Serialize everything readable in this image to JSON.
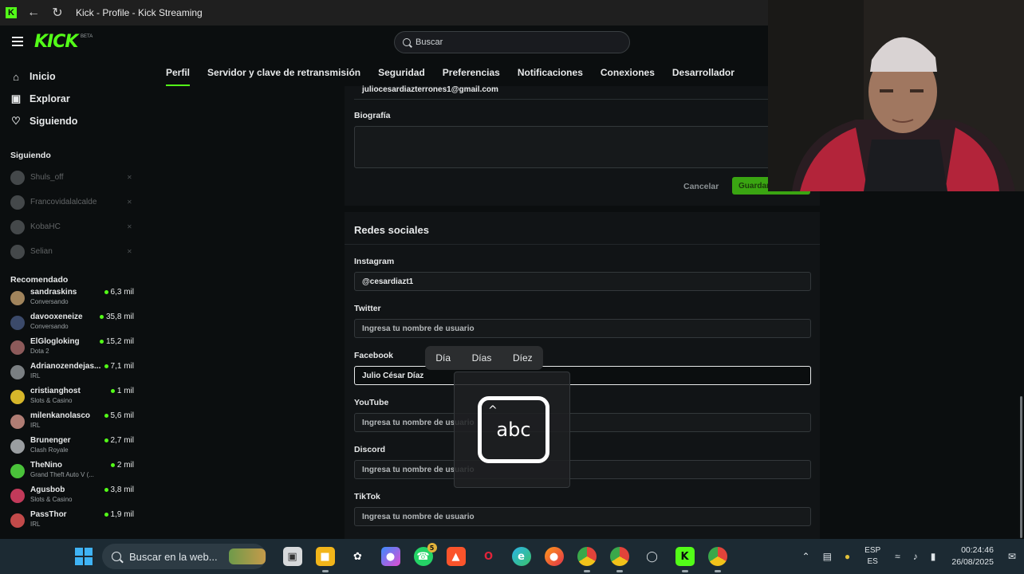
{
  "browser": {
    "title": "Kick - Profile - Kick Streaming"
  },
  "header": {
    "logo": "KICK",
    "logo_badge": "BETA",
    "search_placeholder": "Buscar"
  },
  "sidebar": {
    "nav": [
      {
        "label": "Inicio",
        "icon": "home-icon"
      },
      {
        "label": "Explorar",
        "icon": "compass-icon"
      },
      {
        "label": "Siguiendo",
        "icon": "heart-icon"
      }
    ],
    "following_title": "Siguiendo",
    "following": [
      {
        "name": "Shuls_off"
      },
      {
        "name": "Francovidalalcalde"
      },
      {
        "name": "KobaHC"
      },
      {
        "name": "Selian"
      }
    ],
    "recommended_title": "Recomendado",
    "recommended": [
      {
        "name": "sandraskins",
        "category": "Conversando",
        "viewers": "6,3 mil",
        "color": "#a0845c"
      },
      {
        "name": "davooxeneize",
        "category": "Conversando",
        "viewers": "35,8 mil",
        "color": "#3b4a6a"
      },
      {
        "name": "ElGlogloking",
        "category": "Dota 2",
        "viewers": "15,2 mil",
        "color": "#8c5a5a"
      },
      {
        "name": "Adrianozendejas...",
        "category": "IRL",
        "viewers": "7,1 mil",
        "color": "#7a7f82"
      },
      {
        "name": "cristianghost",
        "category": "Slots & Casino",
        "viewers": "1 mil",
        "color": "#d6b62a"
      },
      {
        "name": "milenkanolasco",
        "category": "IRL",
        "viewers": "5,6 mil",
        "color": "#b07d74"
      },
      {
        "name": "Brunenger",
        "category": "Clash Royale",
        "viewers": "2,7 mil",
        "color": "#9a9ea1"
      },
      {
        "name": "TheNino",
        "category": "Grand Theft Auto V (...",
        "viewers": "2 mil",
        "color": "#4ac23a"
      },
      {
        "name": "Agusbob",
        "category": "Slots & Casino",
        "viewers": "3,8 mil",
        "color": "#c23a5a"
      },
      {
        "name": "PassThor",
        "category": "IRL",
        "viewers": "1,9 mil",
        "color": "#c24a4a"
      }
    ]
  },
  "tabs": [
    {
      "label": "Perfil",
      "active": true
    },
    {
      "label": "Servidor y clave de retransmisión"
    },
    {
      "label": "Seguridad"
    },
    {
      "label": "Preferencias"
    },
    {
      "label": "Notificaciones"
    },
    {
      "label": "Conexiones"
    },
    {
      "label": "Desarrollador"
    }
  ],
  "profile": {
    "email": "juliocesardiazterrones1@gmail.com",
    "bio_label": "Biografía",
    "cancel_label": "Cancelar",
    "save_label": "Guardar"
  },
  "socials": {
    "heading": "Redes sociales",
    "fields": [
      {
        "label": "Instagram",
        "value": "@cesardiazt1",
        "placeholder": ""
      },
      {
        "label": "Twitter",
        "value": "",
        "placeholder": "Ingresa tu nombre de usuario"
      },
      {
        "label": "Facebook",
        "value": "Julio César Díaz",
        "placeholder": ""
      },
      {
        "label": "YouTube",
        "value": "",
        "placeholder": "Ingresa tu nombre de usuario"
      },
      {
        "label": "Discord",
        "value": "",
        "placeholder": "Ingresa tu nombre de usuario"
      },
      {
        "label": "TikTok",
        "value": "",
        "placeholder": "Ingresa tu nombre de usuario"
      }
    ]
  },
  "autocomplete": {
    "suggestions": [
      "Día",
      "Días",
      "Díez"
    ],
    "ime_label": "abc"
  },
  "taskbar": {
    "search_placeholder": "Buscar en la web...",
    "language_top": "ESP",
    "language_bottom": "ES",
    "time": "00:24:46",
    "date": "26/08/2025",
    "whatsapp_badge": "5"
  },
  "colors": {
    "accent": "#53fc18",
    "background": "#0b0e0f",
    "taskbar": "#1c2a33"
  }
}
